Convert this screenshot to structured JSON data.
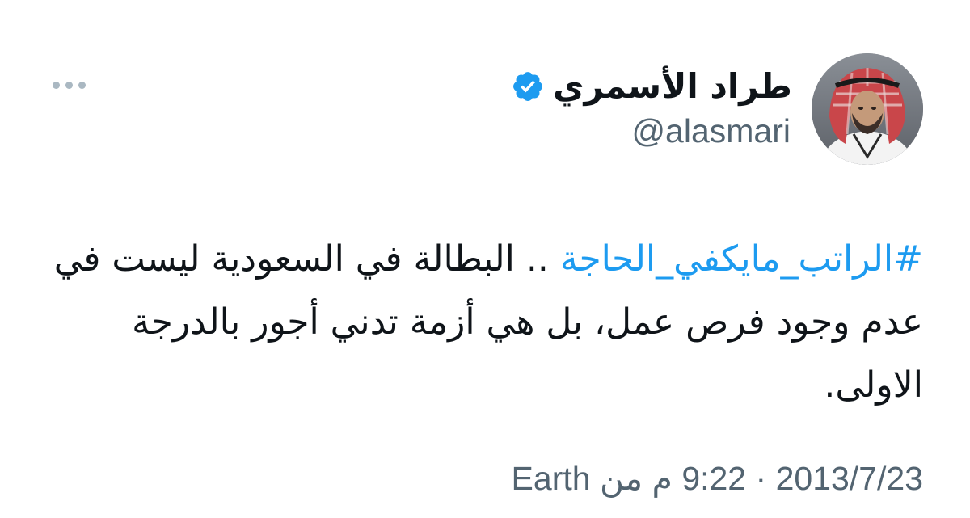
{
  "author": {
    "display_name": "طراد الأسمري",
    "handle": "@alasmari",
    "verified": true,
    "verified_color": "#1d9bf0"
  },
  "tweet": {
    "hashtag": "#الراتب_مايكفي_الحاجة",
    "text": " .. البطالة في السعودية ليست في عدم وجود فرص عمل، بل هي أزمة تدني أجور بالدرجة الاولى."
  },
  "meta": {
    "date": "2013/7/23",
    "separator": "·",
    "time": "9:22 م",
    "source_prefix": "من",
    "source": "Earth"
  },
  "colors": {
    "text": "#0f1419",
    "secondary": "#536471",
    "link": "#1d9bf0"
  },
  "icons": {
    "more": "more-horizontal-icon",
    "verified": "verified-badge-icon"
  }
}
